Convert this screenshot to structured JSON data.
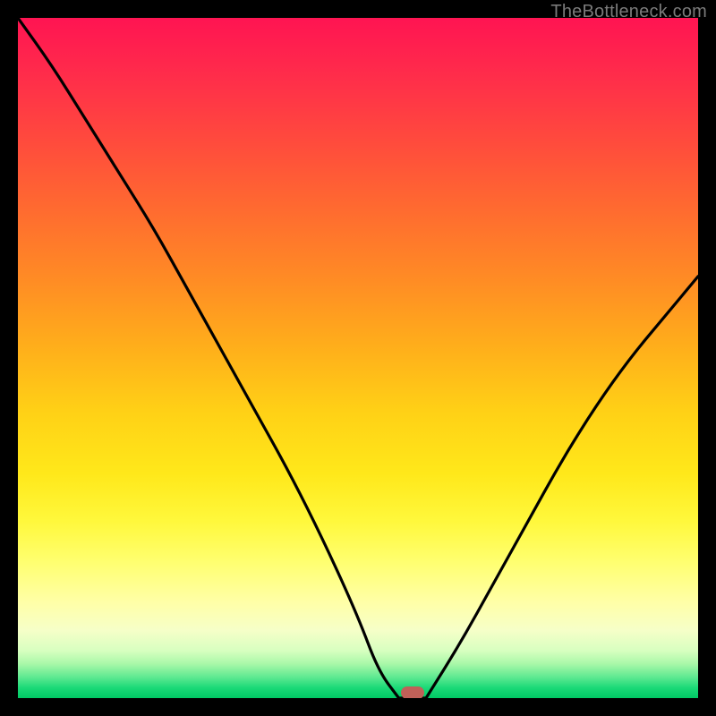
{
  "watermark": "TheBottleneck.com",
  "chart_data": {
    "type": "line",
    "title": "",
    "xlabel": "",
    "ylabel": "",
    "xlim": [
      0,
      100
    ],
    "ylim": [
      0,
      100
    ],
    "grid": false,
    "legend": false,
    "note": "V-shaped bottleneck curve over vertical red→yellow→green gradient; minimum near x≈56 at y≈0.",
    "series": [
      {
        "name": "left-branch",
        "x": [
          0,
          5,
          10,
          15,
          20,
          25,
          30,
          35,
          40,
          45,
          50,
          53,
          56
        ],
        "y": [
          100,
          93,
          85,
          77,
          69,
          60,
          51,
          42,
          33,
          23,
          12,
          4,
          0
        ]
      },
      {
        "name": "floor",
        "x": [
          56,
          60
        ],
        "y": [
          0,
          0
        ]
      },
      {
        "name": "right-branch",
        "x": [
          60,
          65,
          70,
          75,
          80,
          85,
          90,
          95,
          100
        ],
        "y": [
          0,
          8,
          17,
          26,
          35,
          43,
          50,
          56,
          62
        ]
      }
    ],
    "marker": {
      "x": 58,
      "y": 0.8,
      "color": "#c06058"
    },
    "background_gradient_stops": [
      {
        "pos": 0,
        "color": "#ff1452"
      },
      {
        "pos": 50,
        "color": "#ffd116"
      },
      {
        "pos": 85,
        "color": "#ffffa8"
      },
      {
        "pos": 100,
        "color": "#00c964"
      }
    ]
  }
}
